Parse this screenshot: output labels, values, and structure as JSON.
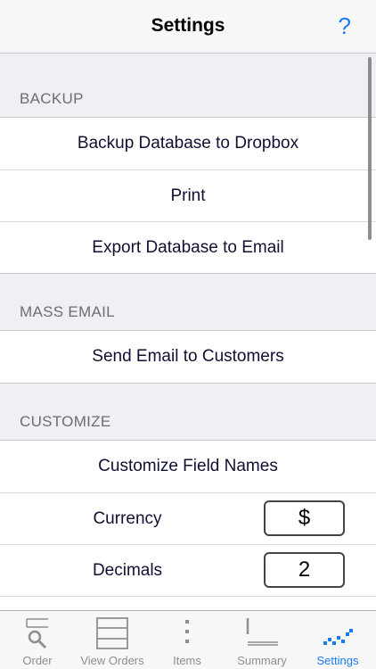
{
  "nav": {
    "title": "Settings",
    "help_label": "?"
  },
  "sections": {
    "backup": {
      "header": "BACKUP",
      "items": [
        "Backup Database to Dropbox",
        "Print",
        "Export Database to Email"
      ]
    },
    "mass_email": {
      "header": "MASS EMAIL",
      "items": [
        "Send Email to Customers"
      ]
    },
    "customize": {
      "header": "CUSTOMIZE",
      "field_names": "Customize Field Names",
      "currency_label": "Currency",
      "currency_value": "$",
      "decimals_label": "Decimals",
      "decimals_value": "2"
    }
  },
  "tabs": [
    {
      "label": "Order",
      "icon": "magnifier-list-icon"
    },
    {
      "label": "View Orders",
      "icon": "grid-table-icon"
    },
    {
      "label": "Items",
      "icon": "vertical-dots-icon"
    },
    {
      "label": "Summary",
      "icon": "summary-lines-icon"
    },
    {
      "label": "Settings",
      "icon": "settings-checks-icon",
      "active": true
    }
  ],
  "colors": {
    "accent": "#1a7cf5",
    "background": "#efeff4"
  }
}
